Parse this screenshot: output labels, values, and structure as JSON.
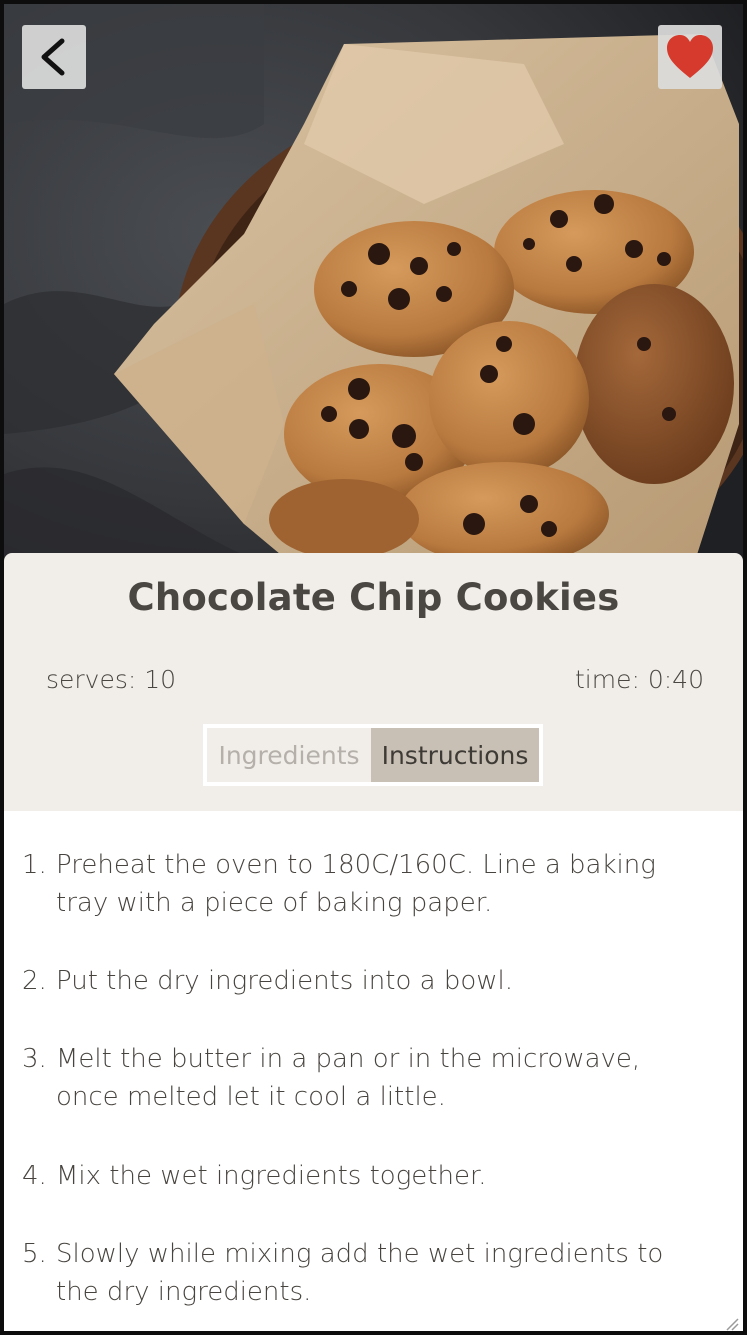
{
  "header": {
    "back_icon": "chevron-left-icon",
    "favorite_icon": "heart-icon",
    "favorite_color": "#d63a2c"
  },
  "recipe": {
    "title": "Chocolate Chip Cookies",
    "serves": "serves: 10",
    "time": "time: 0:40"
  },
  "tabs": [
    {
      "label": "Ingredients",
      "active": false
    },
    {
      "label": "Instructions",
      "active": true
    }
  ],
  "steps": [
    {
      "num": "1.",
      "text": "Preheat the oven to 180C/160C. Line a baking tray with a piece of baking paper."
    },
    {
      "num": "2.",
      "text": "Put the dry ingredients into a bowl."
    },
    {
      "num": "3.",
      "text": "Melt the butter in a pan or in the microwave, once melted let it cool a little."
    },
    {
      "num": "4.",
      "text": "Mix the wet ingredients together."
    },
    {
      "num": "5.",
      "text": "Slowly while mixing add the wet ingredients to the dry ingredients."
    }
  ],
  "colors": {
    "card_background": "#f1eeea",
    "active_tab": "#c8c0b4",
    "text": "#4a4641"
  }
}
